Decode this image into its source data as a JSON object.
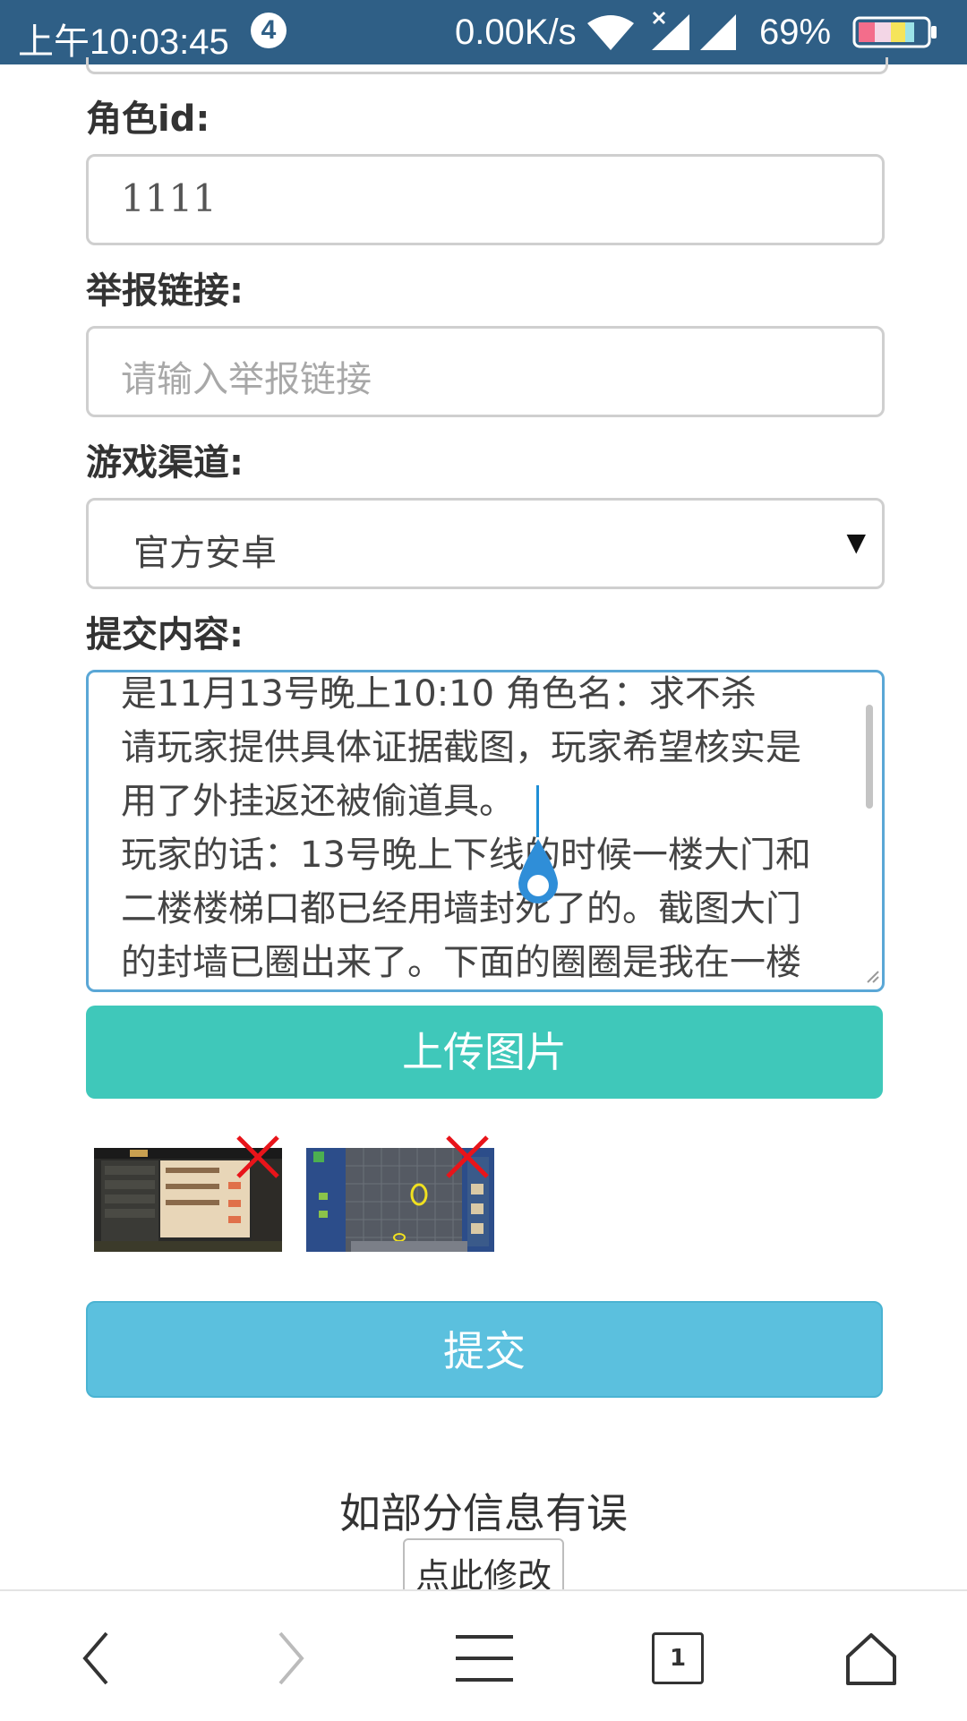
{
  "status_bar": {
    "time": "上午10:03:45",
    "notification_count": "4",
    "net_speed": "0.00K/s",
    "battery_percent": "69%"
  },
  "form": {
    "role_id": {
      "label": "角色id:",
      "value": "1111"
    },
    "report_link": {
      "label": "举报链接:",
      "placeholder": "请输入举报链接"
    },
    "channel": {
      "label": "游戏渠道:",
      "selected": "官方安卓"
    },
    "content": {
      "label": "提交内容:",
      "lines": [
        "是11月13号晚上10:10  角色名：求不杀",
        "请玩家提供具体证据截图，玩家希望核实是",
        "用了外挂返还被偷道具。",
        "玩家的话：13号晚上下线的时候一楼大门和",
        "二楼楼梯口都已经用墙封死了的。截图大门",
        "的封墙已圈出来了。下面的圈圈是我在一楼"
      ]
    },
    "upload_button": "上传图片",
    "submit_button": "提交"
  },
  "thumbnails": [
    {
      "name": "screenshot-1",
      "accent": "#5b4a3a"
    },
    {
      "name": "screenshot-2",
      "accent": "#2c4d8a"
    }
  ],
  "notice": {
    "text": "如部分信息有误",
    "edit_button": "点此修改"
  },
  "bottom_nav": {
    "tab_count": "1",
    "icons": [
      "back-icon",
      "forward-icon",
      "menu-icon",
      "tabs-icon",
      "home-icon"
    ]
  },
  "colors": {
    "status_bar": "#2f5f86",
    "upload": "#3fc8ba",
    "submit": "#5bc0de",
    "focus_border": "#5aa7d6"
  }
}
